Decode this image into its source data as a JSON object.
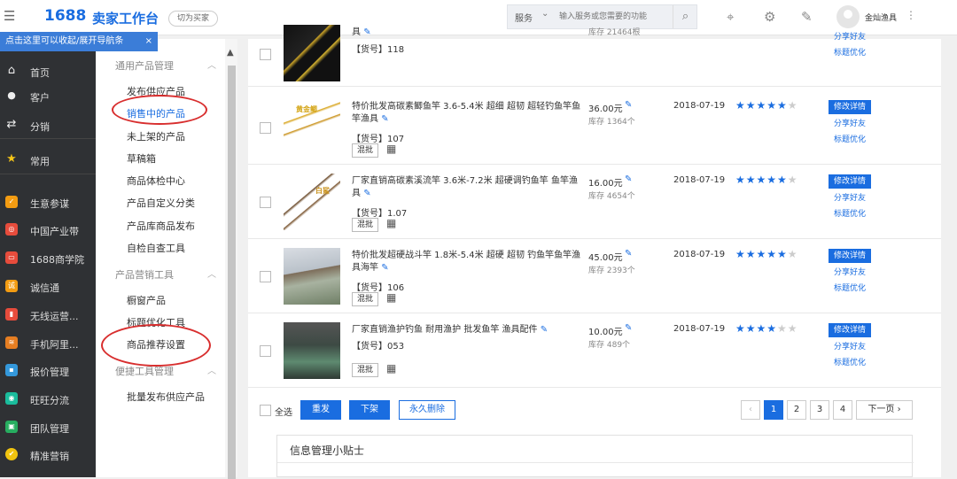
{
  "header": {
    "brand_num": "1688",
    "brand_text": "卖家工作台",
    "switch_label": "切为买家",
    "search_scope": "服务",
    "search_placeholder": "输入服务或您需要的功能",
    "username": "金灿渔具"
  },
  "tip": {
    "text": "点击这里可以收起/展开导航条",
    "close": "×"
  },
  "left_nav": [
    {
      "label": "首页",
      "icon": "home-icon",
      "glyph": "⌂"
    },
    {
      "label": "客户",
      "icon": "user-icon",
      "glyph": "👤"
    },
    {
      "label": "分销",
      "icon": "distribution-icon",
      "glyph": "⇄"
    },
    {
      "label": "常用",
      "icon": "star-icon",
      "glyph": "★"
    },
    {
      "label": "生意参谋",
      "icon": "business-advisor-icon",
      "glyph": "✓"
    },
    {
      "label": "中国产业带",
      "icon": "industry-belt-icon",
      "glyph": "◎"
    },
    {
      "label": "1688商学院",
      "icon": "academy-icon",
      "glyph": "▭"
    },
    {
      "label": "诚信通",
      "icon": "chengxintong-icon",
      "glyph": "诚"
    },
    {
      "label": "无线运营...",
      "icon": "wireless-icon",
      "glyph": "▮"
    },
    {
      "label": "手机阿里...",
      "icon": "mobile-ali-icon",
      "glyph": "≋"
    },
    {
      "label": "报价管理",
      "icon": "quote-icon",
      "glyph": "▪"
    },
    {
      "label": "旺旺分流",
      "icon": "wangwang-icon",
      "glyph": "◉"
    },
    {
      "label": "团队管理",
      "icon": "team-icon",
      "glyph": "▣"
    },
    {
      "label": "精准营销",
      "icon": "marketing-icon",
      "glyph": "✔"
    }
  ],
  "sub_nav": {
    "sec1": "通用产品管理",
    "items1": [
      "发布供应产品",
      "销售中的产品",
      "未上架的产品",
      "草稿箱",
      "商品体检中心",
      "产品自定义分类",
      "产品库商品发布",
      "自检自查工具"
    ],
    "sec2": "产品营销工具",
    "items2": [
      "橱窗产品",
      "标题优化工具",
      "商品推荐设置"
    ],
    "sec3": "便捷工具管理",
    "items3": [
      "批量发布供应产品"
    ]
  },
  "products": [
    {
      "title_tail": "具",
      "sku_label": "【货号】",
      "sku": "118",
      "stock": "库存 21464根",
      "thumb_label": ""
    },
    {
      "title": "特价批发高碳素鲫鱼竿 3.6-5.4米 超细 超韧 超轻钓鱼竿鱼竿渔具",
      "sku_label": "【货号】",
      "sku": "107",
      "wholesale": "混批",
      "price": "36.00元",
      "stock": "库存 1364个",
      "date": "2018-07-19",
      "rating": 5,
      "btn": "修改详情",
      "share": "分享好友",
      "optimize": "标题优化",
      "thumb_label": "黄金鲫"
    },
    {
      "title": "厂家直销高碳素溪流竿 3.6米-7.2米 超硬调钓鱼竿 鱼竿渔具",
      "sku_label": "【货号】",
      "sku": "1.07",
      "wholesale": "混批",
      "price": "16.00元",
      "stock": "库存 4654个",
      "date": "2018-07-19",
      "rating": 5,
      "btn": "修改详情",
      "share": "分享好友",
      "optimize": "标题优化",
      "thumb_label": "白鲨"
    },
    {
      "title": "特价批发超硬战斗竿 1.8米-5.4米 超硬 超韧 钓鱼竿鱼竿渔具海竿",
      "sku_label": "【货号】",
      "sku": "106",
      "wholesale": "混批",
      "price": "45.00元",
      "stock": "库存 2393个",
      "date": "2018-07-19",
      "rating": 5,
      "btn": "修改详情",
      "share": "分享好友",
      "optimize": "标题优化",
      "thumb_label": ""
    },
    {
      "title": "厂家直销渔护钓鱼 耐用渔护 批发鱼竿 渔具配件",
      "sku_label": "【货号】",
      "sku": "053",
      "wholesale": "混批",
      "price": "10.00元",
      "stock": "库存 489个",
      "date": "2018-07-19",
      "rating": 4,
      "btn": "修改详情",
      "share": "分享好友",
      "optimize": "标题优化",
      "thumb_label": ""
    }
  ],
  "row0_links": {
    "share": "分享好友",
    "optimize": "标题优化"
  },
  "bottom": {
    "select_all": "全选",
    "resend": "重发",
    "unlist": "下架",
    "delete": "永久删除",
    "pages": [
      "1",
      "2",
      "3",
      "4"
    ],
    "prev": "‹",
    "next": "下一页 ›"
  },
  "tips": {
    "title": "信息管理小贴士"
  }
}
